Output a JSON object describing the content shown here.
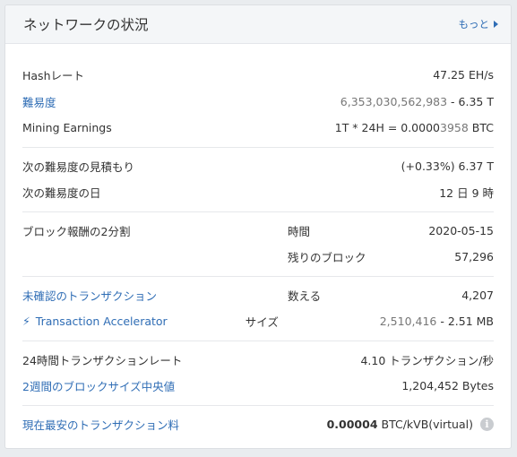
{
  "header": {
    "title": "ネットワークの状況",
    "more_label": "もっと"
  },
  "hashrate": {
    "label": "Hashレート",
    "value": "47.25 EH/s"
  },
  "difficulty": {
    "label": "難易度",
    "value_full": "6,353,030,562,983",
    "value_sep": " - ",
    "value_short": "6.35 T"
  },
  "mining_earnings": {
    "label": "Mining Earnings",
    "prefix": "1T * 24H = 0.0000",
    "digits": "3958",
    "suffix": " BTC"
  },
  "next_difficulty_estimate": {
    "label": "次の難易度の見積もり",
    "value": "(+0.33%) 6.37 T"
  },
  "next_difficulty_date": {
    "label": "次の難易度の日",
    "value": "12 日 9 時"
  },
  "block_halving": {
    "label": "ブロック報酬の2分割",
    "time_label": "時間",
    "time_value": "2020-05-15",
    "remaining_label": "残りのブロック",
    "remaining_value": "57,296"
  },
  "unconfirmed_tx": {
    "label": "未確認のトランザクション",
    "count_label": "数える",
    "count_value": "4,207"
  },
  "tx_accelerator": {
    "label": "Transaction Accelerator",
    "size_label": "サイズ",
    "size_full": "2,510,416",
    "size_sep": " - ",
    "size_short": "2.51 MB"
  },
  "tx_rate_24h": {
    "label": "24時間トランザクションレート",
    "value": "4.10 トランザクション/秒"
  },
  "median_block_size": {
    "label": "2週間のブロックサイズ中央値",
    "value": "1,204,452 Bytes"
  },
  "lowest_fee": {
    "label": "現在最安のトランザクション料",
    "value_bold": "0.00004",
    "value_rest": " BTC/kVB(virtual)"
  },
  "colors": {
    "link": "#2f6db5",
    "muted": "#777777",
    "header_bg": "#f4f6f8"
  }
}
